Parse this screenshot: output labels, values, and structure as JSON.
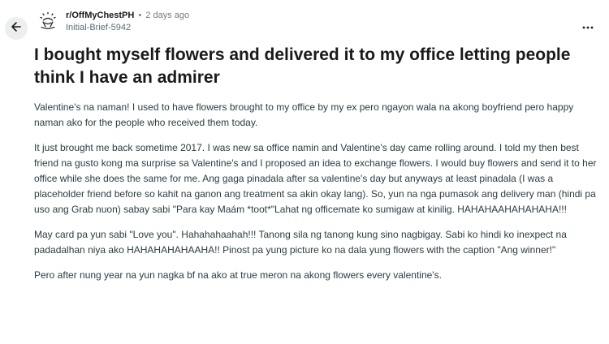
{
  "post": {
    "subreddit": "r/OffMyChestPH",
    "separator": "•",
    "time": "2 days ago",
    "author": "Initial-Brief-5942",
    "title": "I bought myself flowers and delivered it to my office letting people think I have an admirer",
    "paragraphs": [
      "Valentine's na naman! I used to have flowers brought to my office by my ex pero ngayon wala na akong boyfriend pero happy naman ako for the people who received them today.",
      "It just brought me back sometime 2017. I was new sa office namin and Valentine's day came rolling around. I told my then best friend na gusto kong ma surprise sa Valentine's and I proposed an idea to exchange flowers. I would buy flowers and send it to her office while she does the same for me. Ang gaga pinadala after sa valentine's day but anyways at least pinadala (I was a placeholder friend before so kahit na ganon ang treatment sa akin okay lang). So, yun na nga pumasok ang delivery man (hindi pa uso ang Grab nuon) sabay sabi \"Para kay Maám *toot*\"Lahat ng officemate ko sumigaw at kinilig. HAHAHAAHAHAHAHA!!!",
      "May card pa yun sabi \"Love you\". Hahahahaahah!!! Tanong sila ng tanong kung sino nagbigay. Sabi ko hindi ko inexpect na padadalhan niya ako HAHAHAHAHAAHA!! Pinost pa yung picture ko na dala yung flowers with the caption \"Ang winner!\"",
      "Pero after nung year na yun nagka bf na ako at true meron na akong flowers every valentine's."
    ]
  },
  "icons": {
    "back": "arrow-left-icon",
    "subreddit": "subreddit-icon",
    "more": "more-options-icon"
  },
  "colors": {
    "back_button_bg": "#eceef0",
    "title": "#1a1a1b",
    "body_text": "#2a3c42",
    "meta_text": "#7c7c7c"
  }
}
